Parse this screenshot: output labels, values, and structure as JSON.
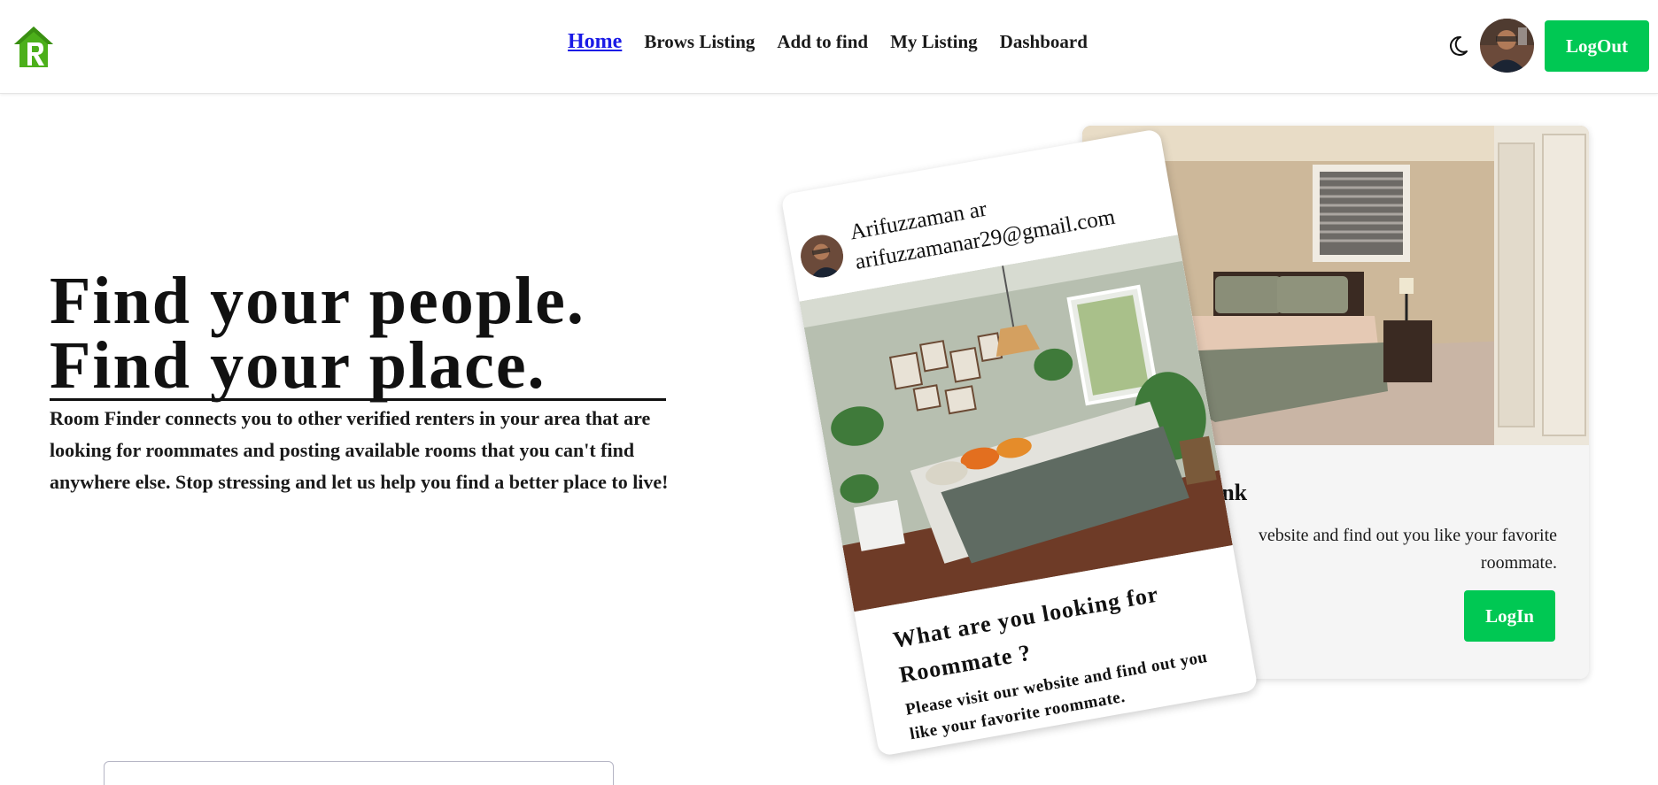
{
  "nav": {
    "links": [
      {
        "label": "Home",
        "active": true
      },
      {
        "label": "Brows Listing"
      },
      {
        "label": "Add to find"
      },
      {
        "label": "My Listing"
      },
      {
        "label": "Dashboard"
      }
    ],
    "logout_label": "LogOut",
    "theme_icon": "moon-icon",
    "logo_icon": "house-logo-icon",
    "accent_color": "#00c853",
    "logo_color": "#4caf1a"
  },
  "hero": {
    "title_line1": "Find your people.",
    "title_line2": "Find your place.",
    "description": "Room Finder connects you to other verified renters in your area that are looking for roommates and posting available rooms that you can't find anywhere else. Stop stressing and let us help you find a better place to live!"
  },
  "back_card": {
    "title_fragment": "ink",
    "text": "vebsite and find out you like your favorite roommate.",
    "login_label": "LogIn"
  },
  "front_card": {
    "name": "Arifuzzaman ar",
    "email": "arifuzzamanar29@gmail.com",
    "title": "What are you looking for Roommate ?",
    "text": "Please visit our website and find out you like your favorite roommate."
  }
}
